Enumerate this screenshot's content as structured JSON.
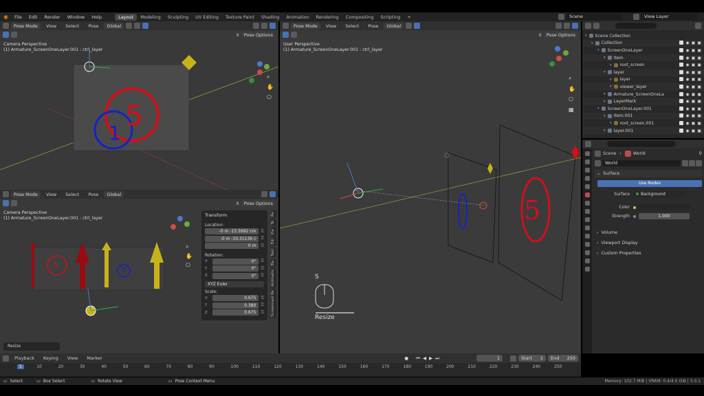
{
  "topbar": {
    "menus": [
      "File",
      "Edit",
      "Render",
      "Window",
      "Help"
    ],
    "workspaces": [
      "Layout",
      "Modeling",
      "Sculpting",
      "UV Editing",
      "Texture Paint",
      "Shading",
      "Animation",
      "Rendering",
      "Compositing",
      "Scripting"
    ],
    "plus": "+",
    "scene": "Scene",
    "view_layer": "View Layer"
  },
  "viewport_tl": {
    "mode": "Pose Mode",
    "menus": [
      "View",
      "Select",
      "Pose"
    ],
    "orientation": "Global",
    "pose_options": "Pose Options",
    "x_label": "X",
    "line1": "Camera Perspective",
    "line2": "(1) Armature_ScreenOneLayer.001 : ctrl_layer"
  },
  "viewport_bl": {
    "mode": "Pose Mode",
    "menus": [
      "View",
      "Select",
      "Pose"
    ],
    "orientation": "Global",
    "pose_options": "Pose Options",
    "x_label": "X",
    "line1": "Camera Perspective",
    "line2": "(1) Armature_ScreenOneLayer.001 : ctrl_layer",
    "tabs": [
      "Re",
      "To",
      "Vie",
      "Edi",
      "Tool",
      "Ba",
      "Animatio",
      "Screencast Ke"
    ],
    "bone_labels": [
      "5",
      "1"
    ],
    "transform": {
      "title": "Transform",
      "location_label": "Location:",
      "location": [
        "-0 m -15.5992 cm",
        "-0 m -10.31136 c",
        "0 m"
      ],
      "rotation_label": "Rotation:",
      "rotation": [
        "0°",
        "0°",
        "0°"
      ],
      "rotation_mode": "XYZ Euler",
      "scale_label": "Scale:",
      "scale": [
        "0.675",
        "0.380",
        "0.675"
      ],
      "axes": [
        "X",
        "Y",
        "Z"
      ]
    },
    "resize_panel": "Resize"
  },
  "viewport_main": {
    "mode": "Pose Mode",
    "menus": [
      "View",
      "Select",
      "Pose"
    ],
    "orientation": "Global",
    "pose_options": "Pose Options",
    "x_label": "X",
    "line1": "User Perspective",
    "line2": "(1) Armature_ScreenOneLayer.001 : ctrl_layer",
    "key": "S",
    "key_action": "Resize",
    "frame_label": "5"
  },
  "outliner": {
    "search_placeholder": "",
    "rows": [
      {
        "label": "Scene Collection",
        "indent": 0
      },
      {
        "label": "Collection",
        "indent": 1
      },
      {
        "label": "ScreenOneLayer",
        "indent": 2
      },
      {
        "label": "Item",
        "indent": 3
      },
      {
        "label": "root_screen",
        "indent": 4
      },
      {
        "label": "layer",
        "indent": 3
      },
      {
        "label": "layer",
        "indent": 4
      },
      {
        "label": "viewer_layer",
        "indent": 4
      },
      {
        "label": "Armature_ScreenOneLa",
        "indent": 3
      },
      {
        "label": "LayerMark",
        "indent": 3
      },
      {
        "label": "ScreenOneLayer.001",
        "indent": 2
      },
      {
        "label": "Item.001",
        "indent": 3
      },
      {
        "label": "root_screen.001",
        "indent": 4
      },
      {
        "label": "layer.001",
        "indent": 3
      }
    ]
  },
  "properties": {
    "breadcrumb_scene": "Scene",
    "breadcrumb_world": "World",
    "world_name": "World",
    "surface": "Surface",
    "use_nodes": "Use Nodes",
    "surface_label": "Surface",
    "surface_value": "Background",
    "color_label": "Color",
    "strength_label": "Strength",
    "strength_value": "1.000",
    "sections": [
      "Volume",
      "Viewport Display",
      "Custom Properties"
    ]
  },
  "timeline": {
    "menus": [
      "Playback",
      "Keying",
      "View",
      "Marker"
    ],
    "current_frame": "1",
    "start_label": "Start",
    "start": "1",
    "end_label": "End",
    "end": "250",
    "ticks": [
      "1",
      "10",
      "20",
      "30",
      "40",
      "50",
      "60",
      "70",
      "80",
      "90",
      "100",
      "110",
      "120",
      "130",
      "140",
      "150",
      "160",
      "170",
      "180",
      "190",
      "200",
      "210",
      "220",
      "230",
      "240",
      "250"
    ]
  },
  "statusbar": {
    "select": "Select",
    "box_select": "Box Select",
    "rotate_view": "Rotate View",
    "context_menu": "Pose Context Menu",
    "memory": "Memory: 102.7 MiB | VRAM: 0.4/4.0 GiB | 3.0.1"
  },
  "colors": {
    "accent": "#4772b3",
    "active_tab": "#474747",
    "red_marker": "#d0101a",
    "blue_marker": "#1422c8",
    "yellow_bone": "#c8b21a"
  }
}
